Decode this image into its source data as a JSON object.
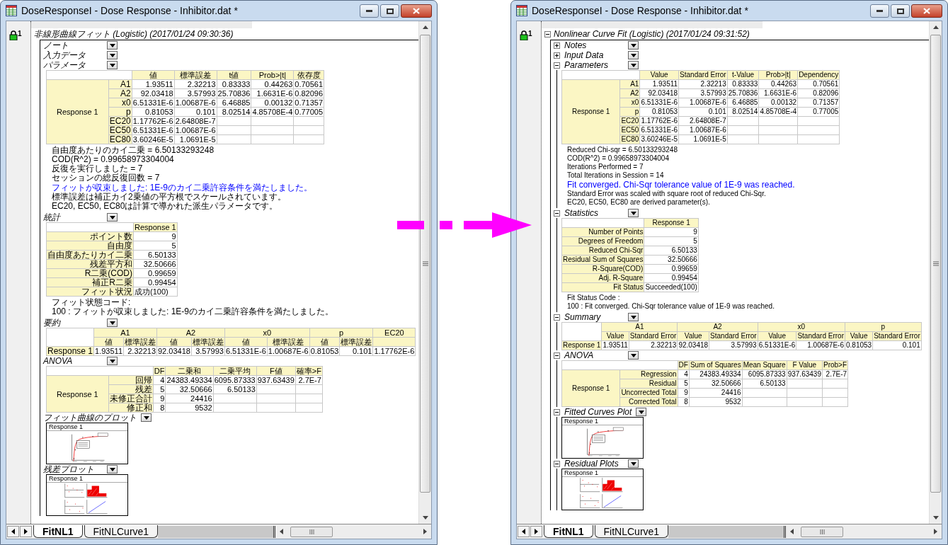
{
  "windows": [
    {
      "title": "DoseResponseI - Dose Response - Inhibitor.dat *",
      "gutter_badge": "1",
      "report": {
        "title": "非線形曲線フィット (Logistic) (2017/01/24 09:30:36)"
      },
      "sections": [
        {
          "kind": "heading",
          "title": "ノート"
        },
        {
          "kind": "heading",
          "title": "入力データ"
        },
        {
          "kind": "table",
          "title": "パラメータ",
          "table": {
            "columns": [
              "値",
              "標準誤差",
              "t値",
              "Prob>|t|",
              "依存度"
            ],
            "group": "Response 1",
            "rows": [
              {
                "label": "A1",
                "cells": [
                  "1.93511",
                  "2.32213",
                  "0.83333",
                  "0.44263",
                  "0.70561"
                ]
              },
              {
                "label": "A2",
                "cells": [
                  "92.03418",
                  "3.57993",
                  "25.70836",
                  "1.6631E-6",
                  "0.82096"
                ]
              },
              {
                "label": "x0",
                "cells": [
                  "6.51331E-6",
                  "1.00687E-6",
                  "6.46885",
                  "0.00132",
                  "0.71357"
                ]
              },
              {
                "label": "p",
                "cells": [
                  "0.81053",
                  "0.101",
                  "8.02514",
                  "4.85708E-4",
                  "0.77005"
                ]
              },
              {
                "label": "EC20",
                "cells": [
                  "1.17762E-6",
                  "2.64808E-7"
                ]
              },
              {
                "label": "EC50",
                "cells": [
                  "6.51331E-6",
                  "1.00687E-6"
                ]
              },
              {
                "label": "EC80",
                "cells": [
                  "3.60246E-5",
                  "1.0691E-5"
                ]
              }
            ]
          },
          "notes": [
            {
              "kind": "plain",
              "text": "自由度あたりのカイ二乗 = 6.50133293248"
            },
            {
              "kind": "plain",
              "text": "COD(R^2) = 0.99658973304004"
            },
            {
              "kind": "plain",
              "text": "反復を実行しました = 7"
            },
            {
              "kind": "plain",
              "text": "セッションの総反復回数 = 7"
            },
            {
              "kind": "emphasis",
              "text": "フィットが収束しました:  1E-9のカイ二乗許容条件を満たしました。"
            },
            {
              "kind": "plain",
              "text": "標準誤差は補正カイ2乗値の平方根でスケールされています。"
            },
            {
              "kind": "plain",
              "text": "EC20, EC50, EC80は計算で導かれた派生パラメータです。"
            }
          ]
        },
        {
          "kind": "table",
          "title": "統計",
          "table": {
            "columns": [
              "Response 1"
            ],
            "rows": [
              {
                "label": "ポイント数",
                "cells": [
                  "9"
                ]
              },
              {
                "label": "自由度",
                "cells": [
                  "5"
                ]
              },
              {
                "label": "自由度あたりカイ二乗",
                "cells": [
                  "6.50133"
                ]
              },
              {
                "label": "残差平方和",
                "cells": [
                  "32.50666"
                ]
              },
              {
                "label": "R二乗(COD)",
                "cells": [
                  "0.99659"
                ]
              },
              {
                "label": "補正R二乗",
                "cells": [
                  "0.99454"
                ]
              },
              {
                "label": "フィット状況",
                "cells": [
                  "成功(100)"
                ]
              }
            ]
          },
          "notes": [
            {
              "kind": "plain",
              "text": "フィット状態コード:"
            },
            {
              "kind": "plain",
              "text": "100 : フィットが収束しました:  1E-9のカイ二乗許容条件を満たしました。"
            }
          ]
        },
        {
          "kind": "table",
          "title": "要約",
          "table": {
            "header_groups": [
              "A1",
              "A2",
              "x0",
              "p",
              "EC20"
            ],
            "columns": [
              "値",
              "標準誤差",
              "値",
              "標準誤差",
              "値",
              "標準誤差",
              "値",
              "標準誤差"
            ],
            "rows": [
              {
                "label": "Response 1",
                "cells": [
                  "1.93511",
                  "2.32213",
                  "92.03418",
                  "3.57993",
                  "6.51331E-6",
                  "1.00687E-6",
                  "0.81053",
                  "0.101",
                  "1.17762E-6"
                ]
              }
            ]
          }
        },
        {
          "kind": "table",
          "title": "ANOVA",
          "table": {
            "columns": [
              "DF",
              "二乗和",
              "二乗平均",
              "F値",
              "確率>F"
            ],
            "group": "Response 1",
            "rows": [
              {
                "label": "回帰",
                "cells": [
                  "4",
                  "24383.49334",
                  "6095.87333",
                  "937.63439",
                  "2.7E-7"
                ]
              },
              {
                "label": "残差",
                "cells": [
                  "5",
                  "32.50666",
                  "6.50133"
                ]
              },
              {
                "label": "未修正合計",
                "cells": [
                  "9",
                  "24416"
                ]
              },
              {
                "label": "修正和",
                "cells": [
                  "8",
                  "9532"
                ]
              }
            ]
          }
        },
        {
          "kind": "fitted_plot",
          "title": "フィット曲線のプロット",
          "plot": {
            "caption": "Response 1"
          }
        },
        {
          "kind": "residual_plot",
          "title": "残差プロット",
          "plot": {
            "caption": "Response 1"
          }
        }
      ],
      "tabs": [
        {
          "label": "FitNL1",
          "selected": true
        },
        {
          "label": "FitNLCurve1",
          "selected": false
        }
      ]
    },
    {
      "title": "DoseResponseI - Dose Response - Inhibitor.dat *",
      "gutter_badge": "1",
      "report": {
        "title": "Nonlinear Curve Fit (Logistic) (2017/01/24 09:31:52)",
        "expanded": true
      },
      "sections": [
        {
          "kind": "heading",
          "title": "Notes",
          "expanded": false
        },
        {
          "kind": "heading",
          "title": "Input Data",
          "expanded": false
        },
        {
          "kind": "table",
          "title": "Parameters",
          "expanded": true,
          "table": {
            "columns": [
              "Value",
              "Standard Error",
              "t-Value",
              "Prob>|t|",
              "Dependency"
            ],
            "group": "Response 1",
            "rows": [
              {
                "label": "A1",
                "cells": [
                  "1.93511",
                  "2.32213",
                  "0.83333",
                  "0.44263",
                  "0.70561"
                ]
              },
              {
                "label": "A2",
                "cells": [
                  "92.03418",
                  "3.57993",
                  "25.70836",
                  "1.6631E-6",
                  "0.82096"
                ]
              },
              {
                "label": "x0",
                "cells": [
                  "6.51331E-6",
                  "1.00687E-6",
                  "6.46885",
                  "0.00132",
                  "0.71357"
                ]
              },
              {
                "label": "p",
                "cells": [
                  "0.81053",
                  "0.101",
                  "8.02514",
                  "4.85708E-4",
                  "0.77005"
                ]
              },
              {
                "label": "EC20",
                "cells": [
                  "1.17762E-6",
                  "2.64808E-7"
                ]
              },
              {
                "label": "EC50",
                "cells": [
                  "6.51331E-6",
                  "1.00687E-6"
                ]
              },
              {
                "label": "EC80",
                "cells": [
                  "3.60246E-5",
                  "1.0691E-5"
                ]
              }
            ]
          },
          "notes": [
            {
              "kind": "plain",
              "text": "Reduced Chi-sqr = 6.50133293248"
            },
            {
              "kind": "plain",
              "text": "COD(R^2) = 0.99658973304004"
            },
            {
              "kind": "plain",
              "text": "Iterations Performed = 7"
            },
            {
              "kind": "plain",
              "text": "Total Iterations in Session = 14"
            },
            {
              "kind": "emphasis",
              "text": "Fit converged. Chi-Sqr tolerance value of 1E-9 was reached."
            },
            {
              "kind": "plain",
              "text": "Standard Error was scaled with square root of reduced Chi-Sqr."
            },
            {
              "kind": "plain",
              "text": "EC20, EC50, EC80 are derived parameter(s)."
            }
          ]
        },
        {
          "kind": "table",
          "title": "Statistics",
          "expanded": true,
          "table": {
            "columns": [
              "Response 1"
            ],
            "rows": [
              {
                "label": "Number of Points",
                "cells": [
                  "9"
                ]
              },
              {
                "label": "Degrees of Freedom",
                "cells": [
                  "5"
                ]
              },
              {
                "label": "Reduced Chi-Sqr",
                "cells": [
                  "6.50133"
                ]
              },
              {
                "label": "Residual Sum of Squares",
                "cells": [
                  "32.50666"
                ]
              },
              {
                "label": "R-Square(COD)",
                "cells": [
                  "0.99659"
                ]
              },
              {
                "label": "Adj. R-Square",
                "cells": [
                  "0.99454"
                ]
              },
              {
                "label": "Fit Status",
                "cells": [
                  "Succeeded(100)"
                ]
              }
            ]
          },
          "notes": [
            {
              "kind": "plain",
              "text": "Fit Status Code :"
            },
            {
              "kind": "plain",
              "text": "100 : Fit converged. Chi-Sqr tolerance value of 1E-9 was reached."
            }
          ]
        },
        {
          "kind": "table",
          "title": "Summary",
          "expanded": true,
          "table": {
            "header_groups": [
              "A1",
              "A2",
              "x0",
              "p"
            ],
            "columns": [
              "Value",
              "Standard Error",
              "Value",
              "Standard Error",
              "Value",
              "Standard Error",
              "Value",
              "Standard Error"
            ],
            "rows": [
              {
                "label": "Response 1",
                "cells": [
                  "1.93511",
                  "2.32213",
                  "92.03418",
                  "3.57993",
                  "6.51331E-6",
                  "1.00687E-6",
                  "0.81053",
                  "0.101"
                ]
              }
            ]
          }
        },
        {
          "kind": "table",
          "title": "ANOVA",
          "expanded": true,
          "table": {
            "columns": [
              "DF",
              "Sum of Squares",
              "Mean Square",
              "F Value",
              "Prob>F"
            ],
            "group": "Response 1",
            "rows": [
              {
                "label": "Regression",
                "cells": [
                  "4",
                  "24383.49334",
                  "6095.87333",
                  "937.63439",
                  "2.7E-7"
                ]
              },
              {
                "label": "Residual",
                "cells": [
                  "5",
                  "32.50666",
                  "6.50133"
                ]
              },
              {
                "label": "Uncorrected Total",
                "cells": [
                  "9",
                  "24416"
                ]
              },
              {
                "label": "Corrected Total",
                "cells": [
                  "8",
                  "9532"
                ]
              }
            ]
          }
        },
        {
          "kind": "fitted_plot",
          "title": "Fitted Curves Plot",
          "expanded": true,
          "plot": {
            "caption": "Response 1"
          }
        },
        {
          "kind": "residual_plot",
          "title": "Residual Plots",
          "expanded": true,
          "plot": {
            "caption": "Response 1"
          }
        }
      ],
      "tabs": [
        {
          "label": "FitNL1",
          "selected": true
        },
        {
          "label": "FitNLCurve1",
          "selected": false
        }
      ]
    }
  ]
}
